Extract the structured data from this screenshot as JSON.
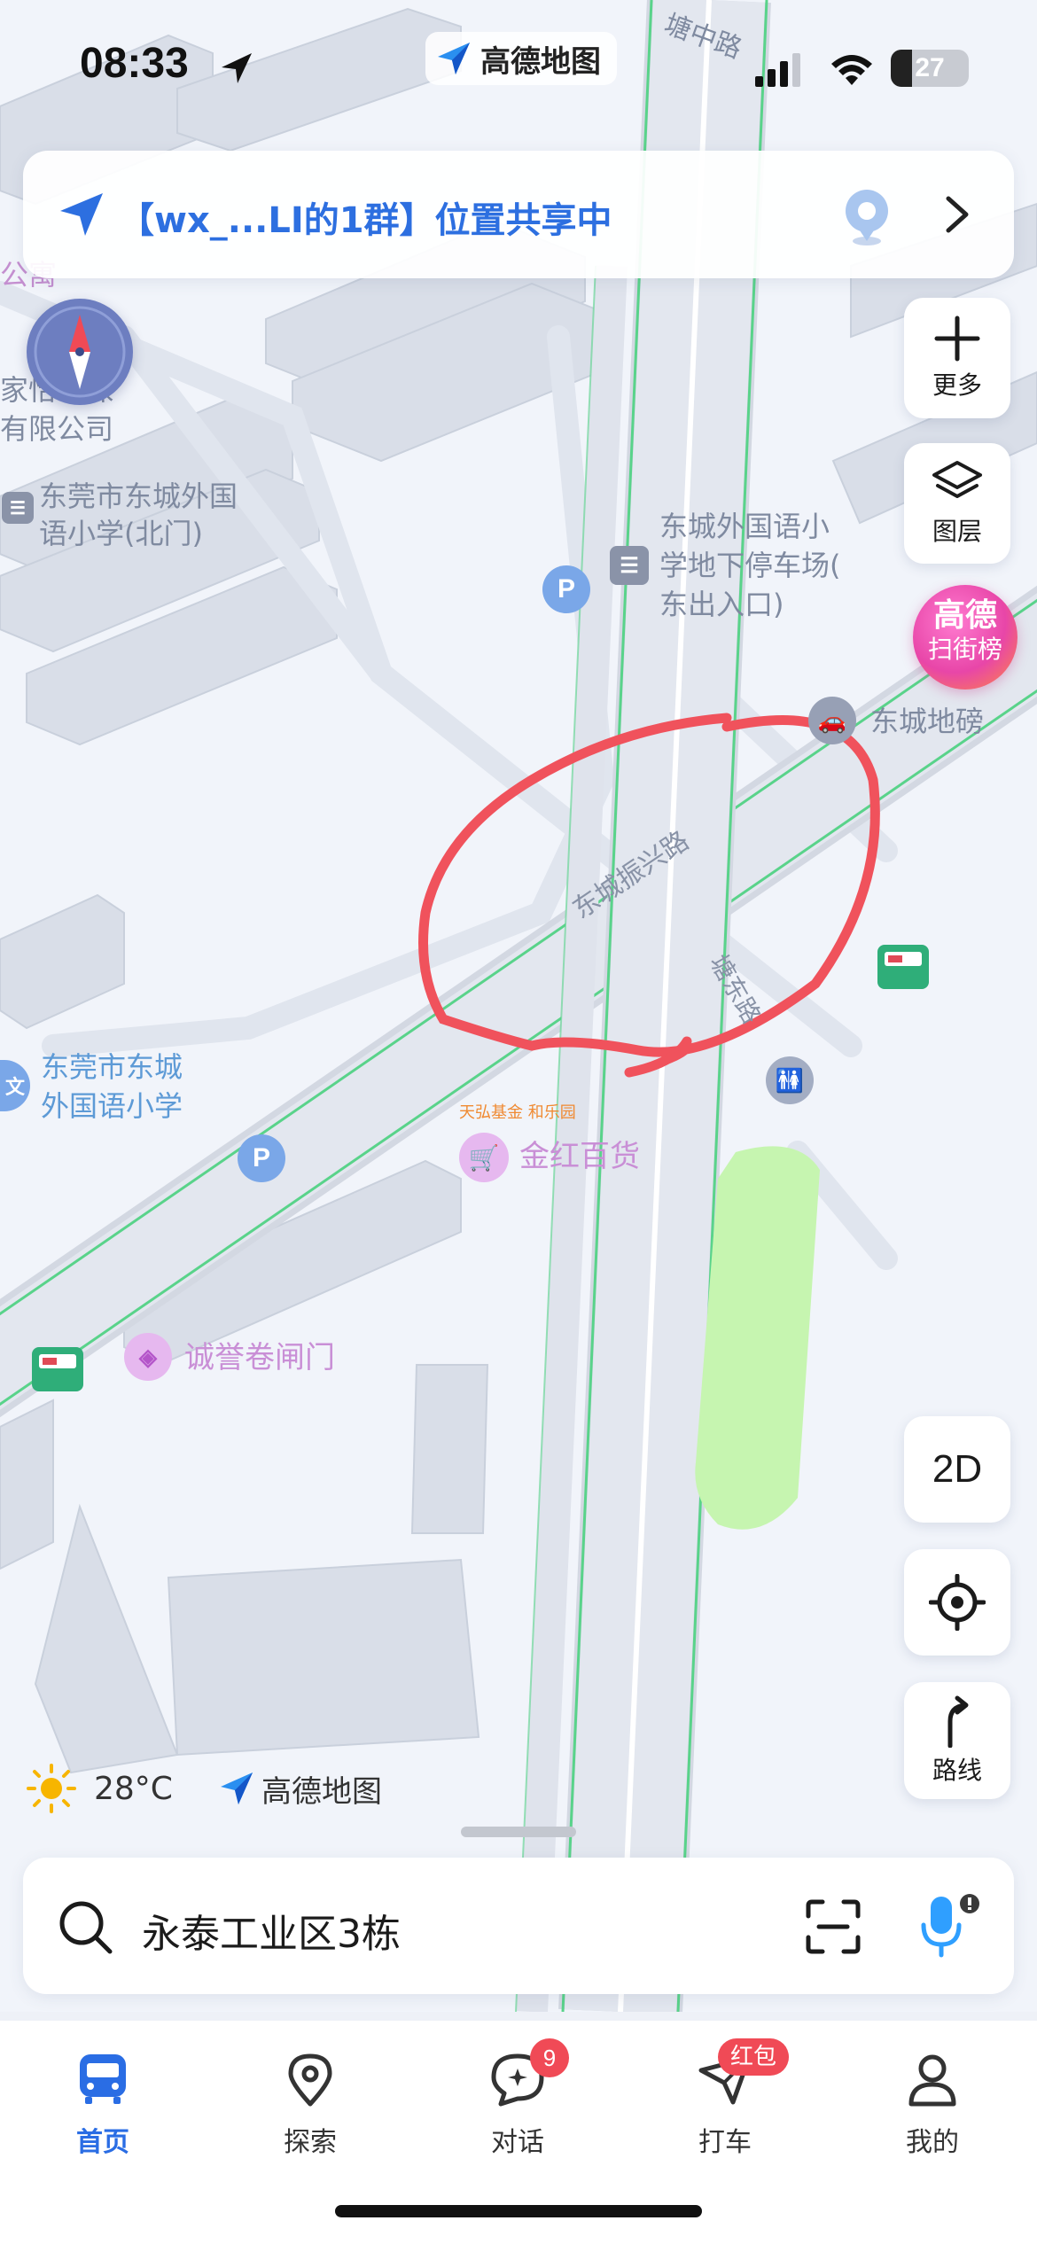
{
  "status_bar": {
    "time": "08:33",
    "app_name": "高德地图",
    "battery": "27"
  },
  "share_bar": {
    "text": "【wx_...LI的1群】位置共享中"
  },
  "map": {
    "labels": {
      "top_road": "塘中路",
      "apartment": "公寓",
      "company_line1": "家怡环保",
      "company_line2": "有限公司",
      "school_north_line1": "东莞市东城外国",
      "school_north_line2": "语小学(北门)",
      "parking_line1": "东城外国语小",
      "parking_line2": "学地下停车场(",
      "parking_line3": "东出入口)",
      "weighbridge": "东城地磅",
      "road_zhenxing": "东城振兴路",
      "road_tangdong": "塘东路",
      "school_line1": "东莞市东城",
      "school_line2": "外国语小学",
      "store": "金红百货",
      "gate": "诚誉卷闸门",
      "tiny_brands": "天弘基金 和乐园"
    },
    "poi_glyphs": {
      "parking": "P"
    }
  },
  "side_controls": {
    "more_label": "更多",
    "layers_label": "图层",
    "badge_line1": "高德",
    "badge_line2": "扫街榜",
    "mode_2d": "2D",
    "route_label": "路线"
  },
  "weather": {
    "temperature": "28°C",
    "brand": "高德地图"
  },
  "search": {
    "value": "永泰工业区3栋"
  },
  "tabs": [
    {
      "label": "首页",
      "icon": "bus-icon",
      "active": true
    },
    {
      "label": "探索",
      "icon": "location-pin-icon",
      "active": false
    },
    {
      "label": "对话",
      "icon": "chat-sparkle-icon",
      "active": false,
      "badge": "9"
    },
    {
      "label": "打车",
      "icon": "taxi-arrow-icon",
      "active": false,
      "badge": "红包"
    },
    {
      "label": "我的",
      "icon": "person-icon",
      "active": false
    }
  ],
  "colors": {
    "accent": "#2a6de4",
    "road_green": "#59d38a",
    "annotation_red": "#f0525c",
    "park": "#c6f5b0"
  }
}
